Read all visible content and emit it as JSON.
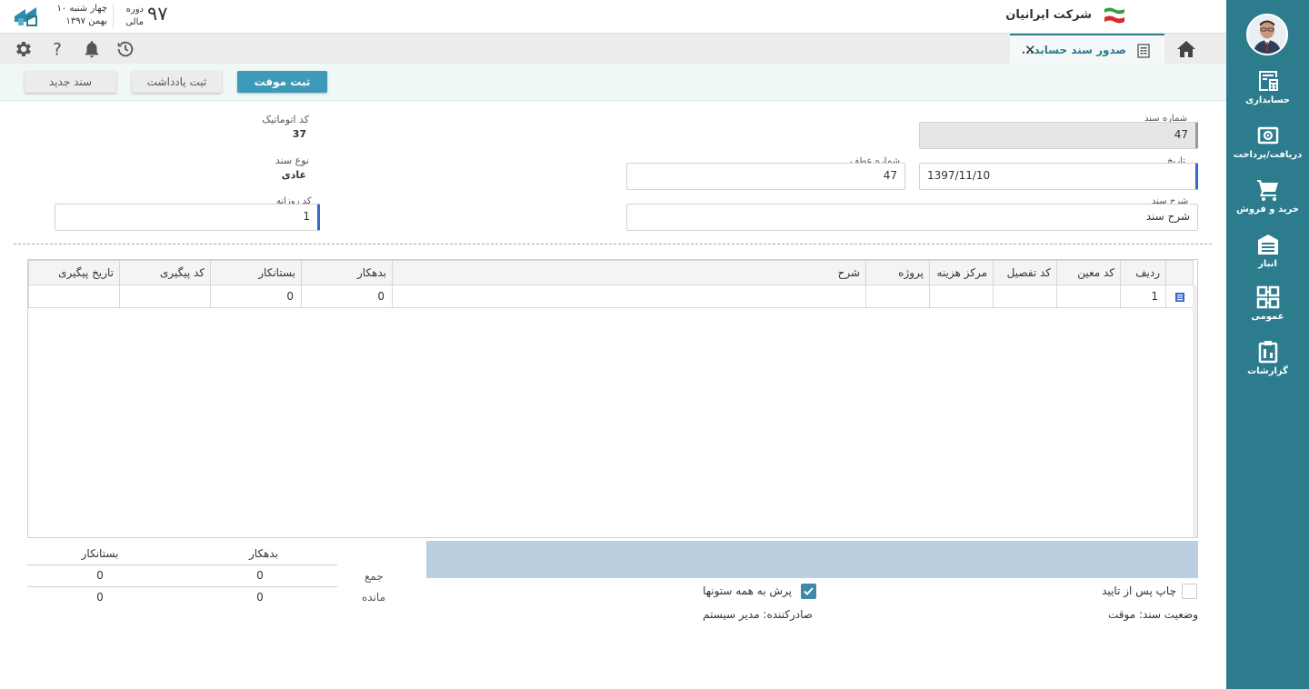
{
  "header": {
    "date_line1": "چهار شنبه ۱۰",
    "date_line2": "بهمن ۱۳۹۷",
    "period_label_line1": "دوره",
    "period_label_line2": "مالی",
    "period_number": "۹۷",
    "company_name": "شرکت ایرانیان"
  },
  "tabs": [
    {
      "label": "صدور سند حسابد..."
    }
  ],
  "toolbar": {
    "save_temp": "ثبت موقت",
    "save_note": "ثبت یادداشت",
    "new_doc": "سند جدید"
  },
  "sidebar": {
    "items": [
      {
        "label": "حسابداری",
        "icon": "accounting-icon"
      },
      {
        "label": "دریافت/پرداخت",
        "icon": "payment-icon"
      },
      {
        "label": "خرید و فروش",
        "icon": "cart-icon"
      },
      {
        "label": "انبار",
        "icon": "warehouse-icon"
      },
      {
        "label": "عمومی",
        "icon": "general-icon"
      },
      {
        "label": "گزارشات",
        "icon": "reports-icon"
      }
    ]
  },
  "form": {
    "doc_number_label": "شماره سند",
    "doc_number": "47",
    "auto_code_label": "کد اتوماتیک",
    "auto_code": "37",
    "date_label": "تاریخ",
    "date": "1397/11/10",
    "ref_number_label": "شماره عطف",
    "ref_number": "47",
    "doc_type_label": "نوع سند",
    "doc_type": "عادی",
    "description_label": "شرح سند",
    "description": "شرح سند",
    "daily_code_label": "کد روزانه",
    "daily_code": "1"
  },
  "grid": {
    "columns": [
      "ردیف",
      "کد معین",
      "کد تفصیل",
      "مرکز هزینه",
      "پروژه",
      "شرح",
      "بدهکار",
      "بستانکار",
      "کد پیگیری",
      "تاریخ پیگیری"
    ],
    "rows": [
      {
        "row": "1",
        "moein": "",
        "tafsil": "",
        "cost_center": "",
        "project": "",
        "desc": "",
        "debit": "0",
        "credit": "0",
        "track_code": "",
        "track_date": ""
      }
    ]
  },
  "summary": {
    "debit_header": "بدهکار",
    "credit_header": "بستانکار",
    "total_label": "جمع",
    "total_debit": "0",
    "total_credit": "0",
    "remain_label": "مانده",
    "remain_debit": "0",
    "remain_credit": "0"
  },
  "footer": {
    "print_after_approve": "چاپ پس از تایید",
    "fill_all_columns": "پرش به همه ستونها",
    "doc_status": "وضعیت سند: موقت",
    "issuer": "صادرکننده: مدیر سیستم"
  },
  "colors": {
    "primary": "#2d7c8e",
    "button": "#3d9ab9",
    "accent_bar": "#3669c9"
  }
}
